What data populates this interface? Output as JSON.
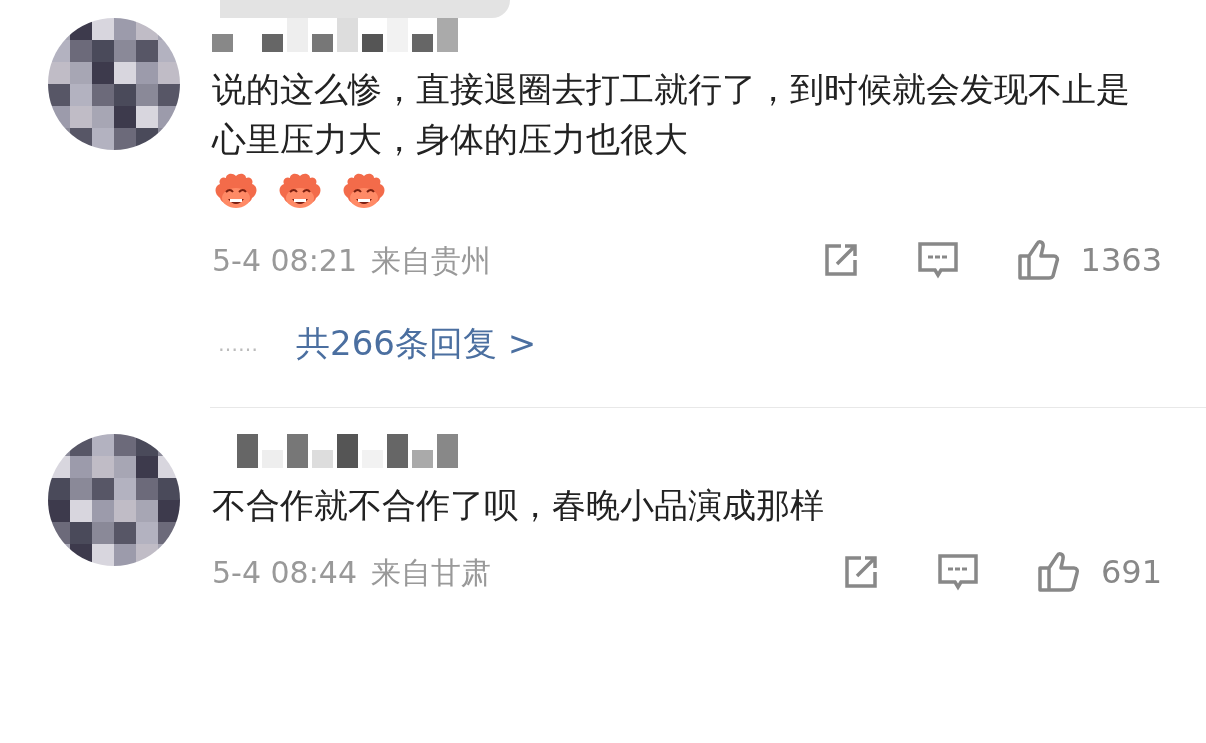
{
  "comments": [
    {
      "avatar": {
        "kind": "pixelated"
      },
      "username": {
        "kind": "pixelated"
      },
      "text": "说的这么惨，直接退圈去打工就行了，到时候就会发现不止是心里压力大，身体的压力也很大",
      "emojis": [
        {
          "kind": "laugh"
        },
        {
          "kind": "laugh"
        },
        {
          "kind": "laugh"
        }
      ],
      "time": "5-4 08:21",
      "location": "来自贵州",
      "likes": "1363",
      "replies": {
        "dots": "……",
        "link": "共266条回复 >"
      }
    },
    {
      "avatar": {
        "kind": "pixelated"
      },
      "username": {
        "kind": "pixelated"
      },
      "text": "不合作就不合作了呗，春晚小品演成那样",
      "time": "5-4 08:44",
      "location": "来自甘肃",
      "likes": "691"
    }
  ]
}
